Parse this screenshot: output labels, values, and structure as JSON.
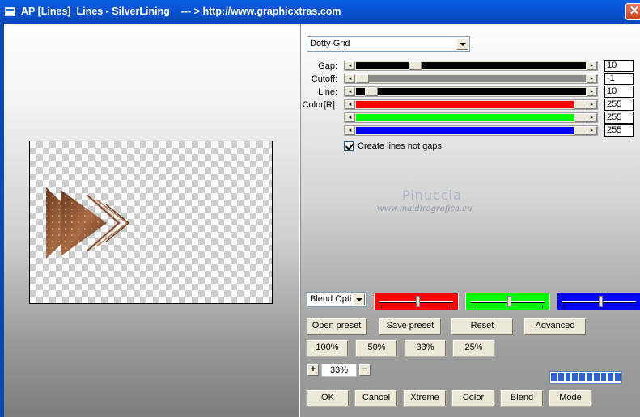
{
  "window": {
    "title": "AP [Lines]  Lines - SilverLining    --- > http://www.graphicxtras.com",
    "close_glyph": "✕"
  },
  "mode_select": {
    "value": "Dotty Grid"
  },
  "sliders": [
    {
      "label": "Gap:",
      "value": "10",
      "track_color": "#000000",
      "thumb_fraction": 0.24
    },
    {
      "label": "Cutoff:",
      "value": "-1",
      "track_color": "#8a8a8a",
      "thumb_fraction": 0.0
    },
    {
      "label": "Line:",
      "value": "10",
      "track_color": "#000000",
      "thumb_fraction": 0.04
    },
    {
      "label": "Color[R]:",
      "value": "255",
      "track_color": "#ff0000",
      "thumb_fraction": 1.0
    },
    {
      "label": "",
      "value": "255",
      "track_color": "#00ff00",
      "thumb_fraction": 1.0
    },
    {
      "label": "",
      "value": "255",
      "track_color": "#0000ff",
      "thumb_fraction": 1.0
    }
  ],
  "checkbox": {
    "label": "Create lines not gaps",
    "checked": true
  },
  "watermark": {
    "name": "Pinuccia",
    "url": "www.maidiregrafica.eu"
  },
  "blend_select": {
    "value": "Blend Optio"
  },
  "color_boxes": [
    {
      "color": "#ff0000",
      "level": 0.5
    },
    {
      "color": "#00ff00",
      "level": 0.5
    },
    {
      "color": "#0000ff",
      "level": 0.5
    }
  ],
  "buttons": {
    "open_preset": "Open preset",
    "save_preset": "Save preset",
    "reset": "Reset",
    "advanced": "Advanced",
    "zoom_100": "100%",
    "zoom_50": "50%",
    "zoom_33": "33%",
    "zoom_25": "25%",
    "ok": "OK",
    "cancel": "Cancel",
    "xtreme": "Xtreme",
    "color": "Color",
    "blend": "Blend",
    "mode": "Mode"
  },
  "zoom": {
    "plus": "+",
    "minus": "−",
    "value": "33%"
  },
  "progress": {
    "segments": 10,
    "filled": 10
  }
}
